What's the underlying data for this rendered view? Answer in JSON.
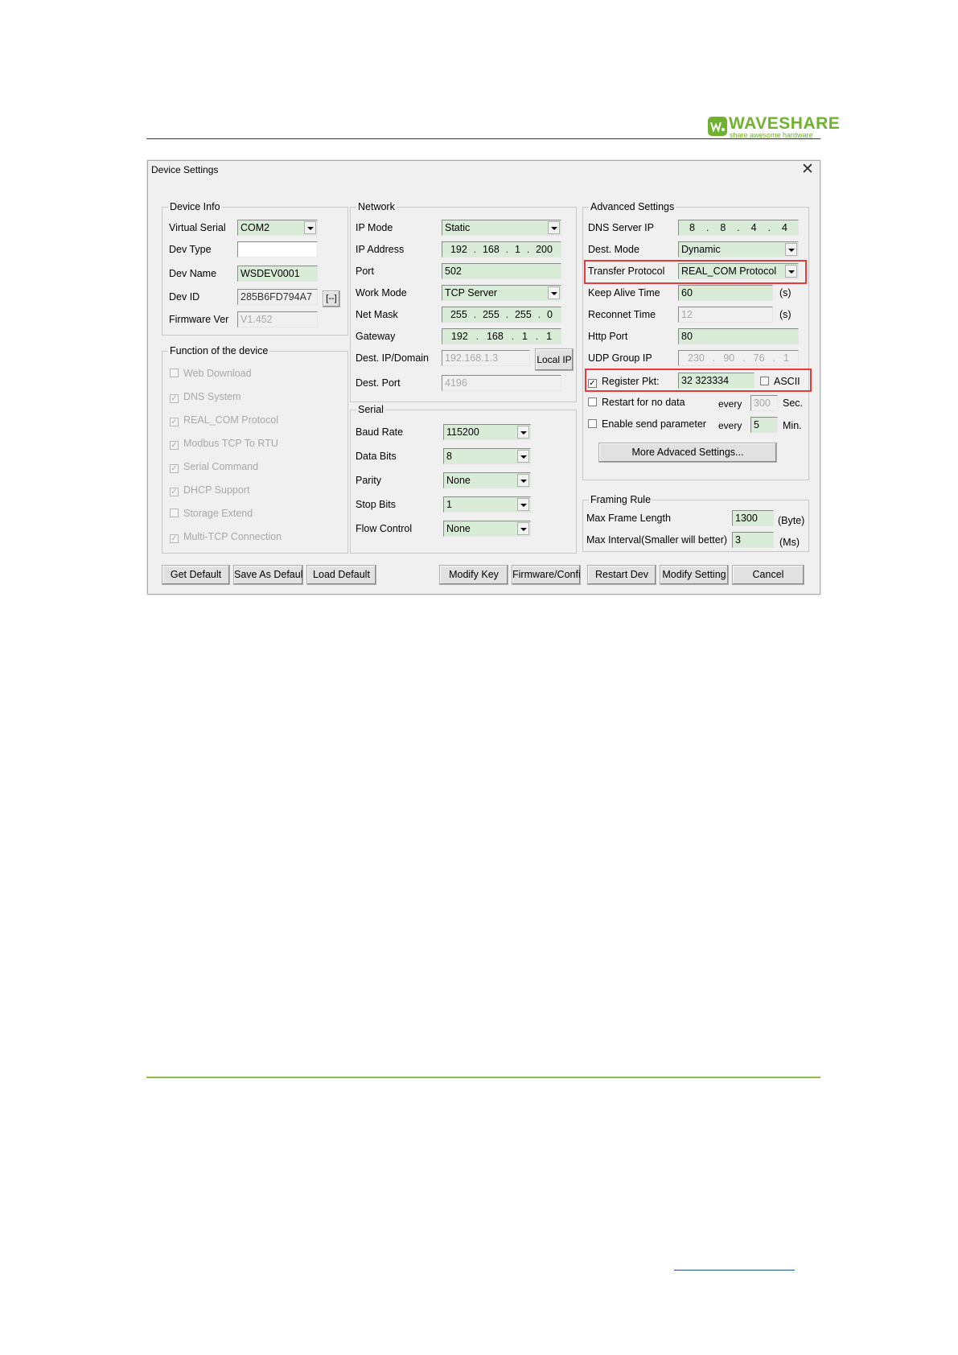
{
  "header": {
    "brand": "WAVESHARE",
    "tagline": "share awesome hardware"
  },
  "dialog": {
    "title": "Device Settings",
    "close": "✕"
  },
  "device_info": {
    "title": "Device Info",
    "virtual_serial_label": "Virtual Serial",
    "virtual_serial": "COM2",
    "dev_type_label": "Dev Type",
    "dev_type": "",
    "dev_name_label": "Dev Name",
    "dev_name": "WSDEV0001",
    "dev_id_label": "Dev ID",
    "dev_id": "285B6FD794A7",
    "dev_id_btn": "[--]",
    "firmware_label": "Firmware Ver",
    "firmware": "V1.452"
  },
  "functions": {
    "title": "Function of the device",
    "items": [
      {
        "label": "Web Download",
        "mark": ""
      },
      {
        "label": "DNS System",
        "mark": "✓"
      },
      {
        "label": "REAL_COM Protocol",
        "mark": "✓"
      },
      {
        "label": "Modbus TCP To RTU",
        "mark": "✓"
      },
      {
        "label": "Serial Command",
        "mark": "✓"
      },
      {
        "label": "DHCP Support",
        "mark": "✓"
      },
      {
        "label": "Storage Extend",
        "mark": ""
      },
      {
        "label": "Multi-TCP Connection",
        "mark": "✓"
      }
    ]
  },
  "network": {
    "title": "Network",
    "ip_mode_label": "IP Mode",
    "ip_mode": "Static",
    "ip_address_label": "IP Address",
    "ip_address": [
      "192",
      "168",
      "1",
      "200"
    ],
    "port_label": "Port",
    "port": "502",
    "work_mode_label": "Work Mode",
    "work_mode": "TCP Server",
    "net_mask_label": "Net Mask",
    "net_mask": [
      "255",
      "255",
      "255",
      "0"
    ],
    "gateway_label": "Gateway",
    "gateway": [
      "192",
      "168",
      "1",
      "1"
    ],
    "dest_ip_label": "Dest. IP/Domain",
    "dest_ip": "192.168.1.3",
    "local_ip_btn": "Local IP",
    "dest_port_label": "Dest. Port",
    "dest_port": "4196"
  },
  "serial": {
    "title": "Serial",
    "baud_rate_label": "Baud Rate",
    "baud_rate": "115200",
    "data_bits_label": "Data Bits",
    "data_bits": "8",
    "parity_label": "Parity",
    "parity": "None",
    "stop_bits_label": "Stop Bits",
    "stop_bits": "1",
    "flow_control_label": "Flow Control",
    "flow_control": "None"
  },
  "advanced": {
    "title": "Advanced Settings",
    "dns_label": "DNS Server IP",
    "dns": [
      "8",
      "8",
      "4",
      "4"
    ],
    "dest_mode_label": "Dest. Mode",
    "dest_mode": "Dynamic",
    "protocol_label": "Transfer Protocol",
    "protocol": "REAL_COM Protocol",
    "keepalive_label": "Keep Alive Time",
    "keepalive": "60",
    "keepalive_unit": "(s)",
    "reconnect_label": "Reconnet Time",
    "reconnect": "12",
    "reconnect_unit": "(s)",
    "http_port_label": "Http Port",
    "http_port": "80",
    "udp_group_label": "UDP Group IP",
    "udp_group": [
      "230",
      "90",
      "76",
      "1"
    ],
    "register_label": "Register Pkt:",
    "register_mark": "✓",
    "register_value": "32 323334",
    "ascii_label": "ASCII",
    "ascii_mark": "",
    "restart_label": "Restart for no data",
    "restart_mark": "",
    "restart_every": "every",
    "restart_value": "300",
    "restart_unit": "Sec.",
    "enable_send_label": "Enable send parameter",
    "enable_send_mark": "",
    "enable_every": "every",
    "enable_value": "5",
    "enable_unit": "Min.",
    "more_btn": "More Advaced Settings..."
  },
  "framing": {
    "title": "Framing Rule",
    "max_frame_label": "Max Frame Length",
    "max_frame": "1300",
    "max_frame_unit": "(Byte)",
    "max_interval_label": "Max Interval(Smaller will better)",
    "max_interval": "3",
    "max_interval_unit": "(Ms)"
  },
  "buttons": {
    "get_default": "Get Default",
    "save_as_default": "Save As Default",
    "load_default": "Load Default",
    "modify_key": "Modify Key",
    "firmware_config": "Firmware/Config",
    "restart_dev": "Restart Dev",
    "modify_setting": "Modify Setting",
    "cancel": "Cancel"
  },
  "colors": {
    "field_bg": "#d9ecd8",
    "highlight": "#e23b3b",
    "brand": "#6fb22f"
  }
}
